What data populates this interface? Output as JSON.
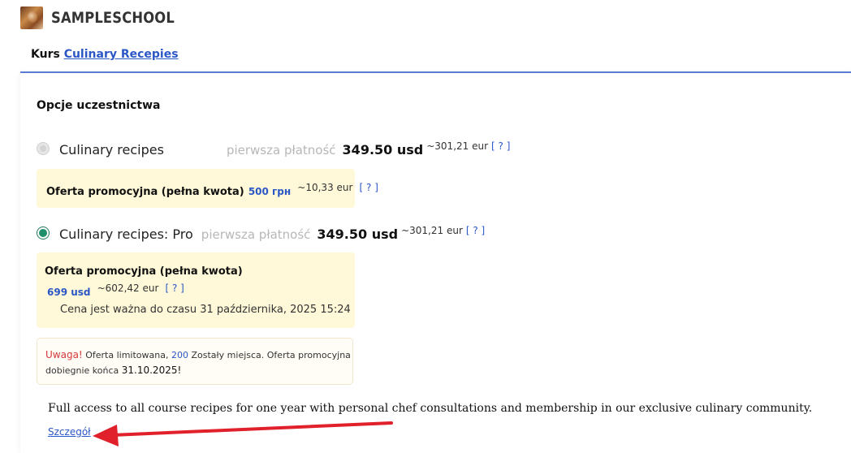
{
  "header": {
    "school_name": "SAMPLESCHOOL"
  },
  "course": {
    "prefix": "Kurs",
    "link": "Culinary Recepies"
  },
  "section": {
    "title": "Opcje uczestnictwa"
  },
  "options": [
    {
      "name": "Culinary recipes",
      "first_payment_label": "pierwsza płatność",
      "price": "349.50 usd",
      "eur": "~301,21 eur",
      "help": "[ ? ]",
      "selected": false,
      "promo": {
        "title": "Oferta promocyjna (pełna kwota)",
        "price": "500 грн",
        "eur": "~10,33 eur",
        "help": "[ ? ]"
      }
    },
    {
      "name": "Culinary recipes: Pro",
      "first_payment_label": "pierwsza płatność",
      "price": "349.50 usd",
      "eur": "~301,21 eur",
      "help": "[ ? ]",
      "selected": true,
      "promo": {
        "title": "Oferta promocyjna (pełna kwota)",
        "price": "699 usd",
        "eur": "~602,42 eur",
        "help": "[ ? ]",
        "valid_until": "Cena jest ważna do czasu 31 października, 2025 15:24"
      }
    }
  ],
  "warning": {
    "label": "Uwaga!",
    "text_before": "Oferta limitowana,",
    "count": "200",
    "text_after": "Zostały miejsca. Oferta promocyjna",
    "line2": "dobiegnie końca",
    "date": "31.10.2025!"
  },
  "description": "Full access to all course recipes for one year with personal chef consultations and membership in our exclusive culinary community.",
  "details_link": "Szczegół",
  "colors": {
    "accent": "#2b57c6",
    "divider": "#5b7fd6",
    "promo_bg": "#fff9d9",
    "radio_checked": "#1f8f6b",
    "warning_red": "#d23a3a",
    "arrow_red": "#e0202a"
  }
}
